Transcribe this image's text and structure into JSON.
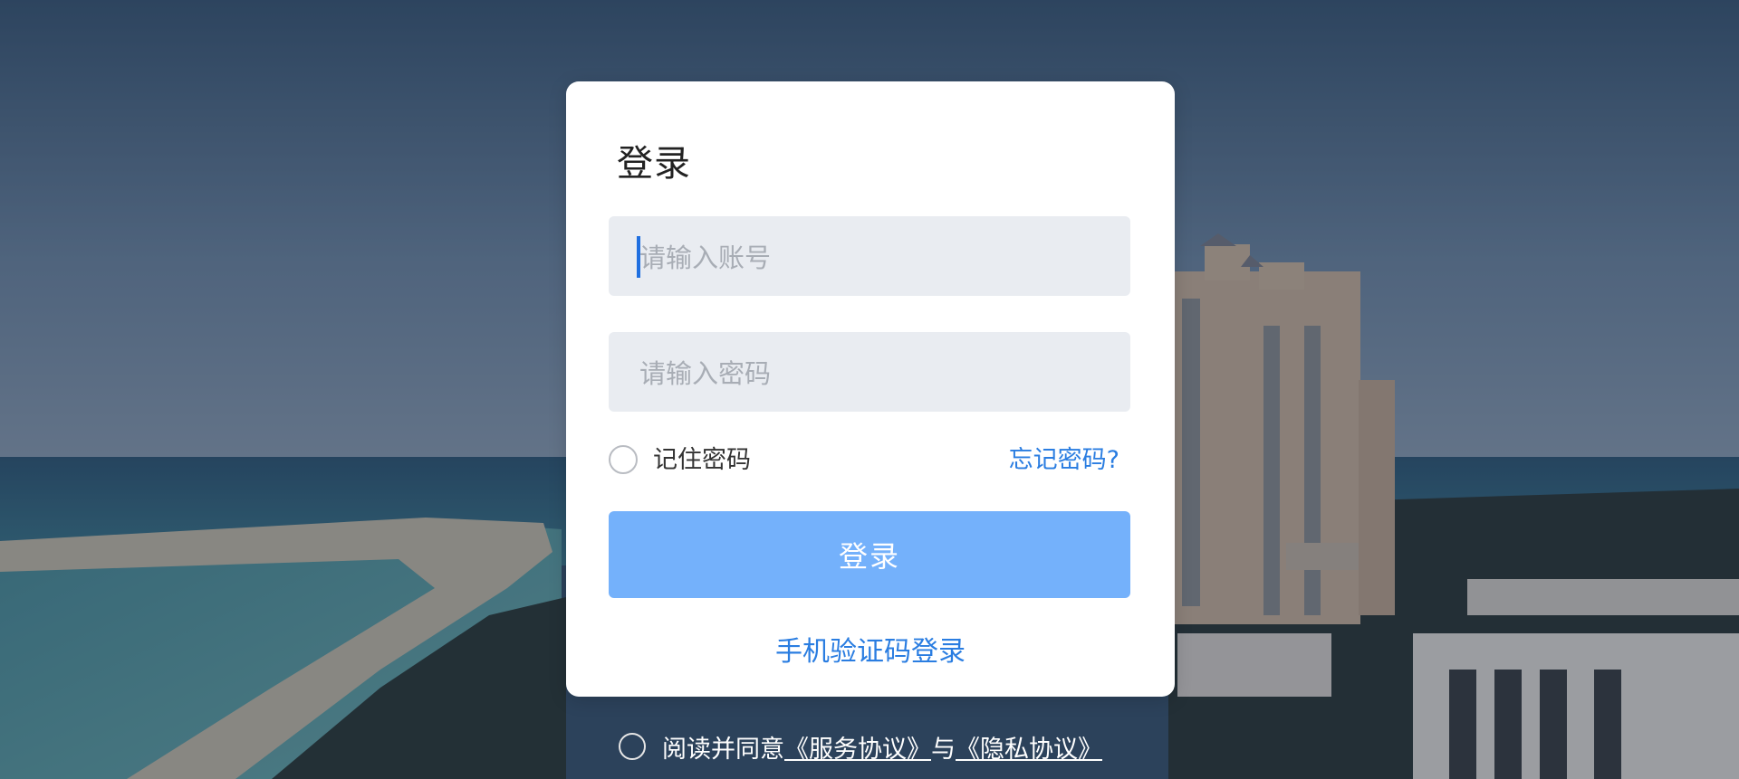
{
  "login": {
    "title": "登录",
    "account_placeholder": "请输入账号",
    "password_placeholder": "请输入密码",
    "remember_label": "记住密码",
    "forgot_label": "忘记密码?",
    "submit_label": "登录",
    "sms_login_label": "手机验证码登录"
  },
  "agreement": {
    "prefix": "阅读并同意",
    "service_link": "《服务协议》",
    "connector": "与",
    "privacy_link": "《隐私协议》"
  },
  "colors": {
    "accent": "#2a7de1",
    "button": "#74b1fb",
    "field_bg": "#e9ecf1"
  }
}
